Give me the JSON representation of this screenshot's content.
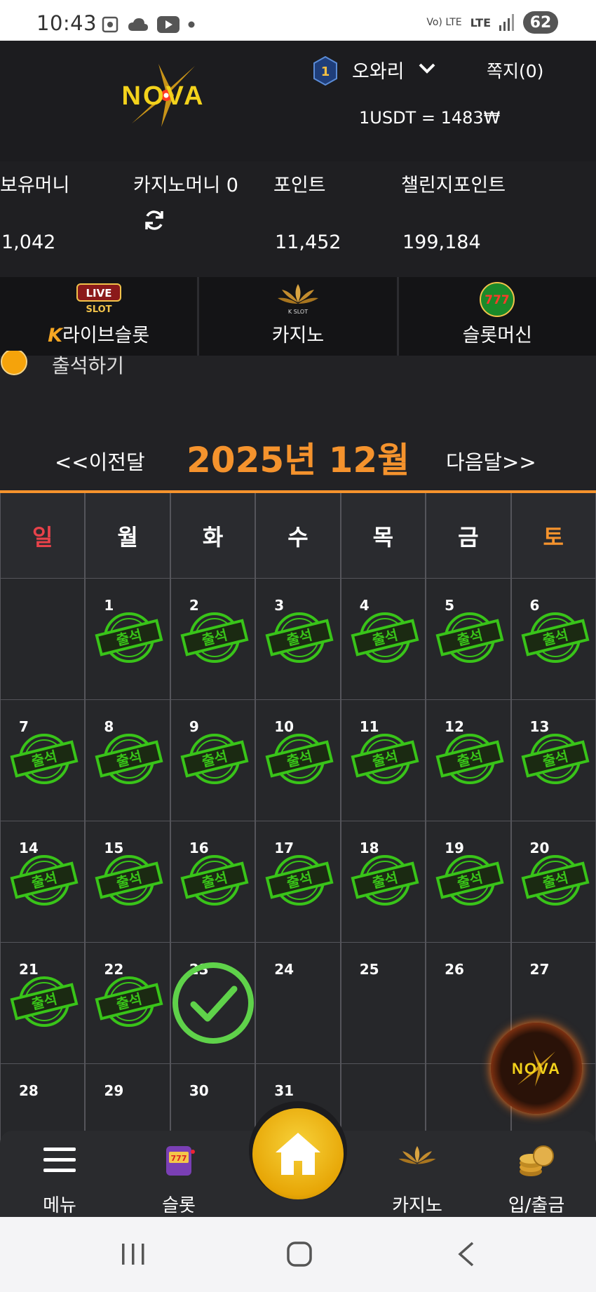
{
  "status_bar": {
    "time": "10:43",
    "network": "LTE",
    "volte": "Vo) LTE",
    "battery": "62"
  },
  "header": {
    "logo_text": "NOVA",
    "rank_badge": "1",
    "username": "오와리",
    "messages": "쪽지(0)",
    "rate": "1USDT = 1483₩"
  },
  "balances": {
    "held_label": "보유머니",
    "held_value": "1,042",
    "casino_label": "카지노머니 0",
    "point_label": "포인트",
    "point_value": "11,452",
    "challenge_label": "챌린지포인트",
    "challenge_value": "199,184"
  },
  "categories": [
    {
      "label": "라이브슬롯",
      "icon": "live-slot-icon",
      "badge": "LIVE",
      "badge2": "SLOT",
      "prefix": "K"
    },
    {
      "label": "카지노",
      "icon": "k-slot-icon",
      "badge": "K SLOT"
    },
    {
      "label": "슬롯머신",
      "icon": "777-slots-icon",
      "badge": "777"
    }
  ],
  "attendance_title": "출석하기",
  "calendar": {
    "prev": "<<이전달",
    "next": "다음달>>",
    "month_title": "2025년 12월",
    "weekdays": [
      "일",
      "월",
      "화",
      "수",
      "목",
      "금",
      "토"
    ],
    "stamp_text": "출석",
    "weeks": [
      [
        "",
        "1",
        "2",
        "3",
        "4",
        "5",
        "6"
      ],
      [
        "7",
        "8",
        "9",
        "10",
        "11",
        "12",
        "13"
      ],
      [
        "14",
        "15",
        "16",
        "17",
        "18",
        "19",
        "20"
      ],
      [
        "21",
        "22",
        "23",
        "24",
        "25",
        "26",
        "27"
      ],
      [
        "28",
        "29",
        "30",
        "31",
        "",
        "",
        ""
      ]
    ],
    "attended": [
      "1",
      "2",
      "3",
      "4",
      "5",
      "6",
      "7",
      "8",
      "9",
      "10",
      "11",
      "12",
      "13",
      "14",
      "15",
      "16",
      "17",
      "18",
      "19",
      "20",
      "21",
      "22"
    ],
    "today": "23",
    "colors": {
      "sunday": "#e8424a",
      "saturday": "#f5932d",
      "stamp": "#39c419",
      "check": "#5fd24a"
    }
  },
  "bottom_nav": {
    "menu": "메뉴",
    "slot": "슬롯",
    "casino": "카지노",
    "cash": "입/출금"
  }
}
